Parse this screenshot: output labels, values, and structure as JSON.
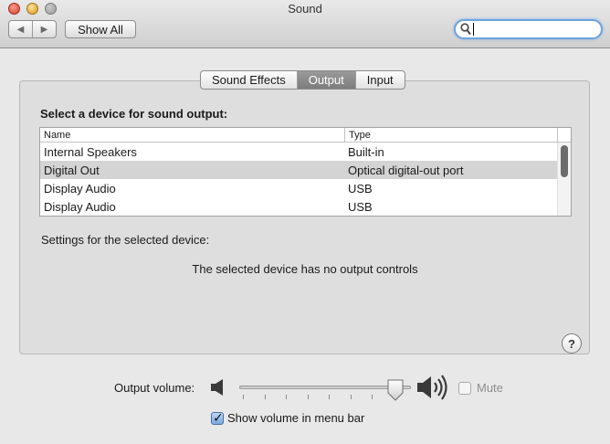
{
  "window": {
    "title": "Sound"
  },
  "toolbar": {
    "back_glyph": "◀",
    "forward_glyph": "▶",
    "show_all_label": "Show All",
    "search_value": ""
  },
  "tabs": [
    {
      "label": "Sound Effects",
      "selected": false
    },
    {
      "label": "Output",
      "selected": true
    },
    {
      "label": "Input",
      "selected": false
    }
  ],
  "output": {
    "section_title": "Select a device for sound output:",
    "columns": [
      "Name",
      "Type"
    ],
    "devices": [
      {
        "name": "Internal Speakers",
        "type": "Built-in",
        "selected": false
      },
      {
        "name": "Digital Out",
        "type": "Optical digital-out port",
        "selected": true
      },
      {
        "name": "Display Audio",
        "type": "USB",
        "selected": false
      },
      {
        "name": "Display Audio",
        "type": "USB",
        "selected": false
      }
    ],
    "settings_label": "Settings for the selected device:",
    "no_controls_message": "The selected device has no output controls",
    "help_glyph": "?"
  },
  "volume": {
    "label": "Output volume:",
    "level": 0.95,
    "mute_label": "Mute",
    "mute_checked": false,
    "mute_enabled": false,
    "show_in_menu_label": "Show volume in menu bar",
    "show_in_menu_checked": true
  },
  "colors": {
    "selected_tab": "#8a8a8a",
    "selected_row": "#d4d4d4",
    "search_focus": "#6fa3db"
  }
}
